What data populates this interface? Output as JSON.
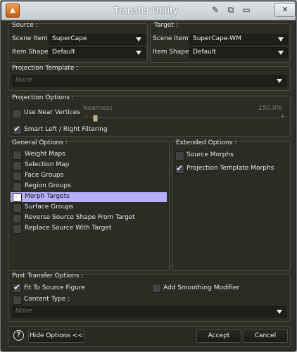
{
  "window": {
    "title": "Transfer Utility"
  },
  "source": {
    "legend": "Source :",
    "scene_item_label": "Scene Item :",
    "scene_item_value": "SuperCape",
    "item_shape_label": "Item Shape :",
    "item_shape_value": "Default"
  },
  "target": {
    "legend": "Target :",
    "scene_item_label": "Scene Item :",
    "scene_item_value": "SuperCape-WM",
    "item_shape_label": "Item Shape :",
    "item_shape_value": "Default"
  },
  "projection_template": {
    "legend": "Projection Template :",
    "value": "None"
  },
  "projection_options": {
    "legend": "Projection Options :",
    "use_near_vertices": {
      "label": "Use Near Vertices",
      "checked": false
    },
    "nearness": {
      "label": "Nearness",
      "value_text": "150.0%",
      "minus": "-",
      "plus": "+",
      "level": 0.21
    },
    "smart_filtering": {
      "label": "Smart Left / Right Filtering",
      "checked": true
    }
  },
  "general_options": {
    "legend": "General Options :",
    "items": [
      {
        "label": "Weight Maps",
        "checked": false,
        "highlighted": false
      },
      {
        "label": "Selection Map",
        "checked": false,
        "highlighted": false
      },
      {
        "label": "Face Groups",
        "checked": false,
        "highlighted": false
      },
      {
        "label": "Region Groups",
        "checked": false,
        "highlighted": false
      },
      {
        "label": "Morph Targets",
        "checked": true,
        "highlighted": true
      },
      {
        "label": "Surface Groups",
        "checked": false,
        "highlighted": false
      },
      {
        "label": "Reverse Source Shape From Target",
        "checked": false,
        "highlighted": false
      },
      {
        "label": "Replace Source With Target",
        "checked": false,
        "highlighted": false
      }
    ]
  },
  "extended_options": {
    "legend": "Extended Options :",
    "items": [
      {
        "label": "Source Morphs",
        "checked": false
      },
      {
        "label": "Projection Template Morphs",
        "checked": true
      }
    ]
  },
  "post_transfer": {
    "legend": "Post Transfer Options :",
    "fit_to_source": {
      "label": "Fit To Source Figure",
      "checked": true
    },
    "add_smoothing": {
      "label": "Add Smoothing Modifier",
      "checked": false
    },
    "content_type": {
      "label": "Content Type :",
      "checked": false,
      "value": "None"
    }
  },
  "footer": {
    "help_symbol": "?",
    "hide_options_label": "Hide Options <<",
    "accept_label": "Accept",
    "cancel_label": "Cancel"
  },
  "colors": {
    "highlight": "#b7aefa",
    "panel": "#2c2c25",
    "window": "#2f2f28"
  }
}
